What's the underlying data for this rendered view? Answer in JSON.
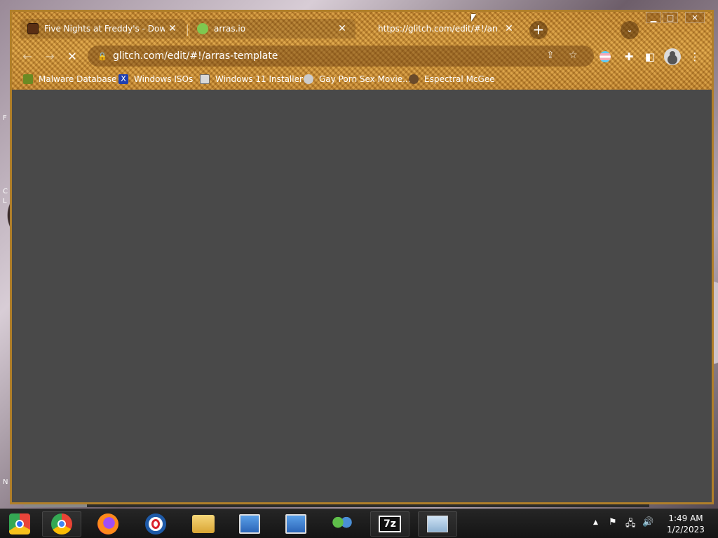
{
  "desktop": {
    "edge_glyphs": [
      "F",
      "C",
      "L",
      "N"
    ]
  },
  "browser": {
    "tabs": [
      {
        "title": "Five Nights at Freddy's - Downlo",
        "favicon": "fnaf-icon",
        "color": "#5a2f14",
        "active": false
      },
      {
        "title": "arras.io",
        "favicon": "arras-icon",
        "color": "#7ec850",
        "active": false
      },
      {
        "title": "https://glitch.com/edit/#!/arras",
        "favicon": "",
        "active": true
      }
    ],
    "tab_close_glyph": "✕",
    "new_tab_glyph": "+",
    "tab_search_glyph": "⌄",
    "window_controls": {
      "minimize": "▁",
      "maximize": "□",
      "close": "✕"
    },
    "nav": {
      "back": "←",
      "forward": "→",
      "stop": "✕"
    },
    "address": {
      "url": "glitch.com/edit/#!/arras-template",
      "lock_icon": "lock-icon"
    },
    "bookmarks": [
      {
        "label": "Malware Database",
        "icon": "leaf-icon",
        "color": "#6b8a23"
      },
      {
        "label": "Windows ISOs",
        "icon": "x-icon",
        "color": "#1f3fb0"
      },
      {
        "label": "Windows 11 Installer",
        "icon": "installer-icon",
        "color": "#d8d8d8"
      },
      {
        "label": "Gay Porn Sex Movie...",
        "icon": "gear-icon",
        "color": "#cccccc"
      },
      {
        "label": "Espectral McGee",
        "icon": "face-icon",
        "color": "#6a4a2a"
      }
    ],
    "accent": "#b07f2a"
  },
  "taskbar": {
    "apps": [
      {
        "name": "chrome-beta-icon"
      },
      {
        "name": "chrome-icon"
      },
      {
        "name": "firefox-icon"
      },
      {
        "name": "opera-icon"
      },
      {
        "name": "file-explorer-icon"
      },
      {
        "name": "network-setup-icon"
      },
      {
        "name": "network-setup-icon-2"
      },
      {
        "name": "people-icon"
      },
      {
        "name": "seven-zip-icon",
        "label": "7z"
      },
      {
        "name": "resource-monitor-icon"
      }
    ],
    "tray": {
      "chevron": "▲",
      "flag": "⚑",
      "network": "🖧",
      "volume": "🔊"
    },
    "clock": {
      "time": "1:49 AM",
      "date": "1/2/2023"
    }
  }
}
